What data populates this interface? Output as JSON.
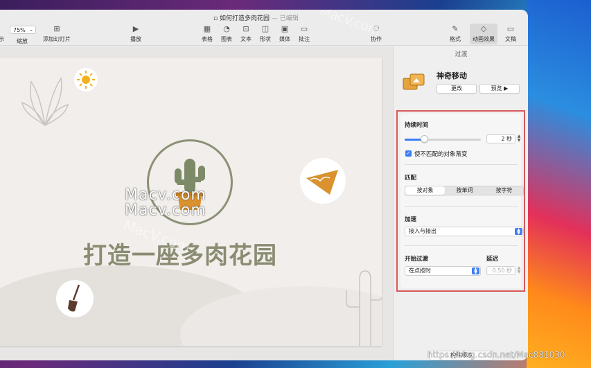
{
  "window": {
    "title": "如何打造多肉花园",
    "title_status": "— 已编辑"
  },
  "toolbar": {
    "show_label": "示",
    "zoom_value": "75%",
    "zoom_label": "缩放",
    "add_slide_label": "添加幻灯片",
    "play_label": "播放",
    "table_label": "表格",
    "chart_label": "图表",
    "text_label": "文本",
    "shape_label": "形状",
    "media_label": "媒体",
    "comment_label": "批注",
    "collaborate_label": "协作",
    "format_label": "格式",
    "animate_label": "动画效果",
    "document_label": "文稿"
  },
  "slide": {
    "title_text": "打造一座多肉花园",
    "watermark_main": "Macv.com",
    "watermark_top": "MacV.com",
    "watermark_faint": "MacV.com"
  },
  "sidebar": {
    "header": "过渡",
    "animation_name": "神奇移动",
    "change_button": "更改",
    "preview_button": "预览 ▶",
    "duration_label": "持续时间",
    "duration_value": "2 秒",
    "duration_fraction": 0.25,
    "fade_checkbox_label": "使不匹配的对象渐变",
    "fade_checked": true,
    "match_label": "匹配",
    "match_options": [
      "按对象",
      "按单词",
      "按字符"
    ],
    "match_selected": 0,
    "accel_label": "加速",
    "accel_value": "接入与接出",
    "start_label": "开始过渡",
    "start_value": "在点按时",
    "delay_label": "延迟",
    "delay_value": "0.50 秒",
    "build_order_button": "构件顺序"
  },
  "footer": {
    "csdn_watermark": "https://blog.csdn.net/Mac881030"
  },
  "colors": {
    "accent": "#3d7ef5",
    "highlight_box": "#d9595a",
    "slide_title": "#8a8c72"
  }
}
